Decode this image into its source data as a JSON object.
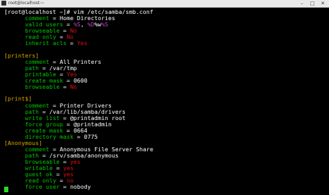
{
  "window": {
    "title": "root@localhost:~",
    "min_glyph": "–",
    "max_glyph": "□",
    "close_glyph": "✕",
    "icon": "terminal-icon"
  },
  "terminal": {
    "prompt": "[root@localhost ~]# vim /etc/samba/smb.conf",
    "colors": {
      "background": "#000000",
      "text": "#ffffff",
      "key": "#00c800",
      "boolean": "#e01010",
      "section": "#d8a800",
      "macro": "#c040c0",
      "cursor": "#22dd22"
    },
    "lines": [
      {
        "key": "comment",
        "value": "Home Directories",
        "indent": true
      },
      {
        "key": "valid users",
        "value_parts": [
          "%S",
          ", ",
          "%D",
          "%w",
          "%S"
        ],
        "indent": true
      },
      {
        "key": "browseable",
        "value": "No",
        "indent": true
      },
      {
        "key": "read only",
        "value": "No",
        "indent": true
      },
      {
        "key": "inherit acls",
        "value": "Yes",
        "indent": true
      },
      {
        "section": "[printers]"
      },
      {
        "key": "comment",
        "value": "All Printers",
        "indent": true
      },
      {
        "key": "path",
        "value": "/var/tmp",
        "indent": true
      },
      {
        "key": "printable",
        "value": "Yes",
        "indent": true
      },
      {
        "key": "create mask",
        "value": "0600",
        "indent": true
      },
      {
        "key": "browseable",
        "value": "No",
        "indent": true
      },
      {
        "section": "[print$]"
      },
      {
        "key": "comment",
        "value": "Printer Drivers",
        "indent": true
      },
      {
        "key": "path",
        "value": "/var/lib/samba/drivers",
        "indent": true
      },
      {
        "key": "write list",
        "value": "@printadmin root",
        "indent": true
      },
      {
        "key": "force group",
        "value": "@printadmin",
        "indent": true
      },
      {
        "key": "create mask",
        "value": "0664",
        "indent": true
      },
      {
        "key": "directory mask",
        "value": "0775",
        "indent": true
      },
      {
        "section": "[Anonymous]"
      },
      {
        "key": "comment",
        "value": "Anonymous File Server Share",
        "indent": true
      },
      {
        "key": "path",
        "value": "/srv/samba/anonymous",
        "indent": true
      },
      {
        "key": "browseable",
        "value": "yes",
        "indent": true
      },
      {
        "key": "writable",
        "value": "yes",
        "indent": true
      },
      {
        "key": "guest ok",
        "value": "yes",
        "indent": true
      },
      {
        "key": "read only",
        "value": "no",
        "indent": true
      },
      {
        "key": "force user",
        "value": "nobody",
        "indent": true
      }
    ]
  }
}
